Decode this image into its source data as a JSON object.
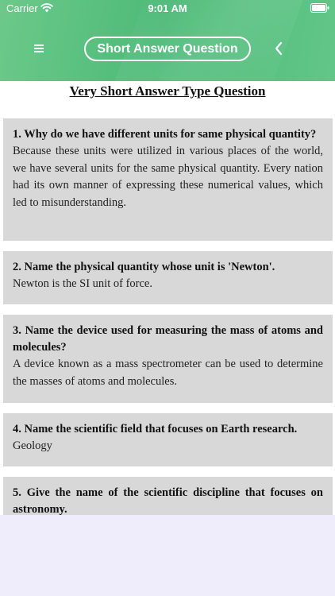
{
  "status_bar": {
    "carrier": "Carrier",
    "time": "9:01 AM"
  },
  "header": {
    "title": "Short Answer Question",
    "menu_icon": "hamburger-menu-icon",
    "back_icon": "chevron-left-icon",
    "gradient_colors": [
      "#6cc98a",
      "#4dba78",
      "#62c688"
    ]
  },
  "section": {
    "title": "Very Short Answer Type Question"
  },
  "qa_items": [
    {
      "question": "1. Why do we have different units for same physical quantity?",
      "answer": "Because these units were utilized in various places of the world, we have several units for the same physical quantity. Every nation had its own manner of expressing these numerical values, which led to misunderstanding."
    },
    {
      "question": "2. Name the physical quantity whose unit is 'Newton'.",
      "answer": "Newton is the SI unit of force."
    },
    {
      "question": "3. Name the device used for measuring the mass of atoms and molecules?",
      "answer": "A device known as a mass spectrometer can be used to determine the masses of atoms and molecules."
    },
    {
      "question": "4. Name the scientific field that focuses on Earth research.",
      "answer": "Geology"
    },
    {
      "question": "5. Give the name of the scientific discipline that focuses on astronomy.",
      "answer": ""
    }
  ],
  "colors": {
    "card_background": "#d8d8d8",
    "bottom_background": "#efedfb"
  }
}
